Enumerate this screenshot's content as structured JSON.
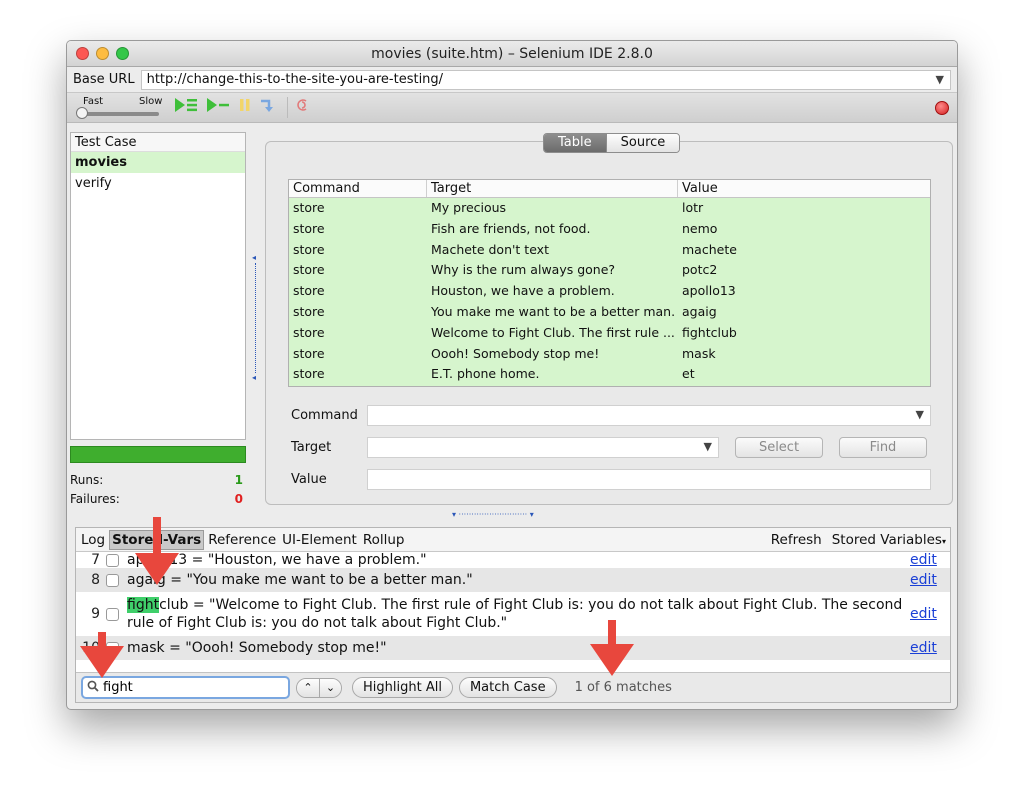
{
  "window": {
    "title": "movies (suite.htm) – Selenium IDE 2.8.0",
    "traffic_colors": [
      "#fc5753",
      "#fdbc40",
      "#33c748"
    ]
  },
  "base_url": {
    "label": "Base URL",
    "value": "http://change-this-to-the-site-you-are-testing/"
  },
  "toolbar": {
    "speed_fast": "Fast",
    "speed_slow": "Slow",
    "icons": [
      "play-suite-icon",
      "play-test-icon",
      "pause-icon",
      "step-icon",
      "rollup-icon",
      "record-icon"
    ]
  },
  "test_cases": {
    "header": "Test Case",
    "items": [
      "movies",
      "verify"
    ]
  },
  "stats": {
    "runs_label": "Runs:",
    "runs_value": "1",
    "failures_label": "Failures:",
    "failures_value": "0"
  },
  "view_toggle": {
    "table": "Table",
    "source": "Source"
  },
  "commands_table": {
    "headers": [
      "Command",
      "Target",
      "Value"
    ],
    "rows": [
      [
        "store",
        "My precious",
        "lotr"
      ],
      [
        "store",
        "Fish are friends, not food.",
        "nemo"
      ],
      [
        "store",
        "Machete don't text",
        "machete"
      ],
      [
        "store",
        "Why is the rum always gone?",
        "potc2"
      ],
      [
        "store",
        "Houston, we have a problem.",
        "apollo13"
      ],
      [
        "store",
        "You make me want to be a better man.",
        "agaig"
      ],
      [
        "store",
        "Welcome to Fight Club. The first rule ...",
        "fightclub"
      ],
      [
        "store",
        "Oooh! Somebody stop me!",
        "mask"
      ],
      [
        "store",
        "E.T. phone home.",
        "et"
      ]
    ]
  },
  "editor": {
    "command_label": "Command",
    "target_label": "Target",
    "value_label": "Value",
    "select_button": "Select",
    "find_button": "Find"
  },
  "bottom_tabs": {
    "log": "Log",
    "stored_vars": "Stored-Vars",
    "reference": "Reference",
    "ui_element": "UI-Element",
    "rollup": "Rollup",
    "refresh": "Refresh",
    "stored_variables": "Stored Variables"
  },
  "stored_vars": [
    {
      "num": "7",
      "text": "apollo13 = \"Houston, we have a problem.\"",
      "edit": "edit"
    },
    {
      "num": "8",
      "text": "agaig = \"You make me want to be a better man.\"",
      "edit": "edit"
    },
    {
      "num": "9",
      "hl": "fight",
      "text_after": "club = \"Welcome to Fight Club. The first rule of Fight Club is: you do not talk about Fight Club. The second rule of Fight Club is: you do not talk about Fight Club.\"",
      "edit": "edit"
    },
    {
      "num": "10",
      "text": "mask = \"Oooh! Somebody stop me!\"",
      "edit": "edit"
    }
  ],
  "find_bar": {
    "query": "fight",
    "highlight_all": "Highlight All",
    "match_case": "Match Case",
    "status": "1 of 6 matches"
  },
  "colors": {
    "selected_green": "#d6f5cd",
    "progress_green": "#3fae2e",
    "annotation_red": "#e8473d",
    "link_blue": "#1a3fd6"
  }
}
